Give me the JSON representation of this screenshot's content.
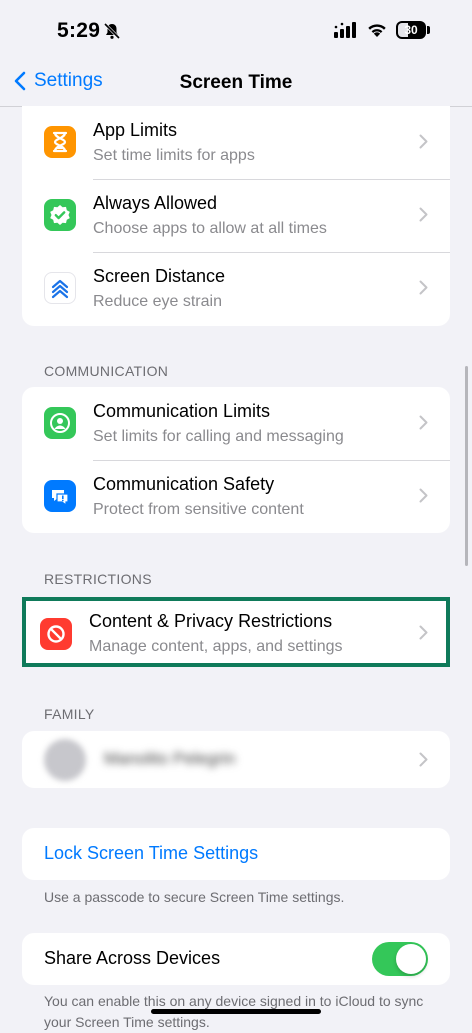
{
  "status": {
    "time": "5:29",
    "battery": "30"
  },
  "nav": {
    "back_label": "Settings",
    "title": "Screen Time"
  },
  "limits": [
    {
      "title": "App Limits",
      "subtitle": "Set time limits for apps",
      "icon": "hourglass-icon",
      "color": "#ff9500"
    },
    {
      "title": "Always Allowed",
      "subtitle": "Choose apps to allow at all times",
      "icon": "checkmark-badge-icon",
      "color": "#34c759"
    },
    {
      "title": "Screen Distance",
      "subtitle": "Reduce eye strain",
      "icon": "chevrons-up-icon",
      "color": "#ffffff"
    }
  ],
  "communication": {
    "header": "COMMUNICATION",
    "items": [
      {
        "title": "Communication Limits",
        "subtitle": "Set limits for calling and messaging",
        "icon": "person-circle-icon",
        "color": "#34c759"
      },
      {
        "title": "Communication Safety",
        "subtitle": "Protect from sensitive content",
        "icon": "chat-alert-icon",
        "color": "#007aff"
      }
    ]
  },
  "restrictions": {
    "header": "RESTRICTIONS",
    "item": {
      "title": "Content & Privacy Restrictions",
      "subtitle": "Manage content, apps, and settings",
      "icon": "prohibited-icon",
      "color": "#ff3b30"
    }
  },
  "family": {
    "header": "FAMILY",
    "member_name": "Manolito Pelegrin"
  },
  "lock": {
    "label": "Lock Screen Time Settings",
    "footnote": "Use a passcode to secure Screen Time settings."
  },
  "share": {
    "label": "Share Across Devices",
    "enabled": true,
    "footnote": "You can enable this on any device signed in to iCloud to sync your Screen Time settings."
  },
  "colors": {
    "accent": "#007aff",
    "highlight_border": "#0f7a5a",
    "toggle_on": "#34c759"
  }
}
